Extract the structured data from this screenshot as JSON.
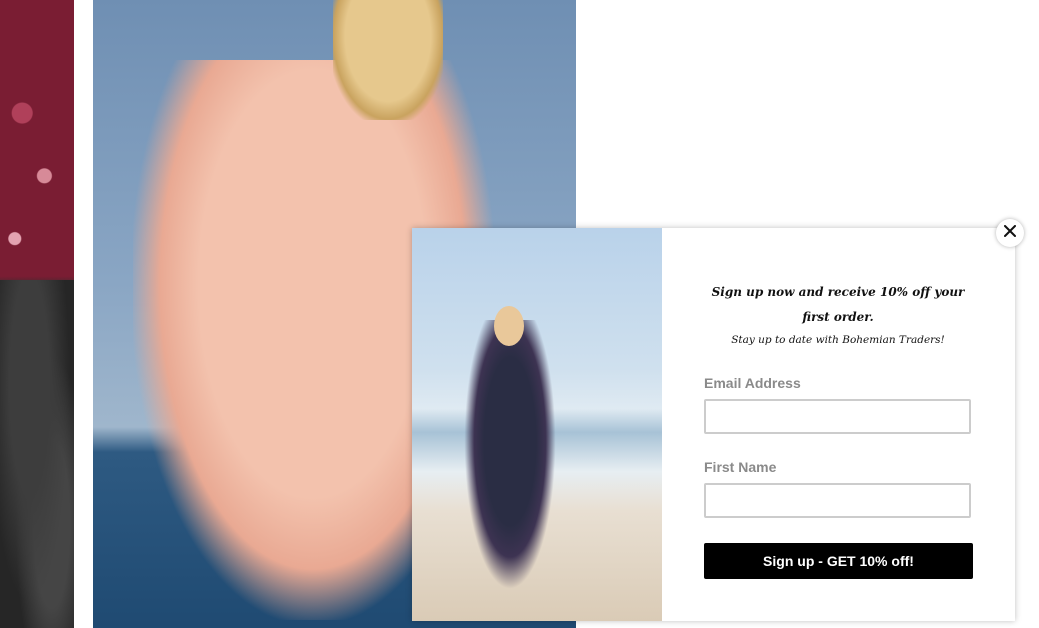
{
  "popup": {
    "headline": "Sign up now and receive 10% off your first order.",
    "subline": "Stay up to date with Bohemian Traders!",
    "email_label": "Email Address",
    "email_value": "",
    "first_name_label": "First Name",
    "first_name_value": "",
    "submit_label": "Sign up - GET 10% off!",
    "close_icon": "close-icon"
  },
  "colors": {
    "button_bg": "#000000",
    "button_text": "#ffffff",
    "label_text": "#8a8a8a",
    "input_border": "#cccccc"
  }
}
